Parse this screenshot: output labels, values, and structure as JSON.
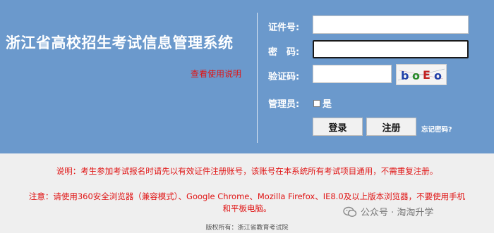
{
  "header": {
    "title": "浙江省高校招生考试信息管理系统",
    "manual_link": "查看使用说明"
  },
  "login_form": {
    "id_label": "证件号:",
    "id_value": "",
    "password_label": "密　码:",
    "password_value": "",
    "captcha_label": "验证码:",
    "captcha_value": "",
    "captcha_image_text": "boEo",
    "admin_label": "管理员:",
    "admin_option": "是",
    "admin_checked": false,
    "login_button": "登录",
    "register_button": "注册",
    "forgot_link": "忘记密码?"
  },
  "notices": {
    "explanation": "说明：考生参加考试报名时请先以有效证件注册账号，该账号在本系统所有考试项目通用，不需重复注册。",
    "attention_line1": "注意：请使用360安全浏览器（兼容模式）、Google Chrome、Mozilla Firefox、IE8.0及以上版本浏览器，不要使用手机",
    "attention_line2": "和平板电脑。"
  },
  "watermark": {
    "text": "公众号 · 淘淘升学",
    "icon": "wechat-icon"
  },
  "footer": {
    "copyright": "版权所有：浙江省教育考试院"
  },
  "colors": {
    "banner": "#6b99cc",
    "notice_red": "#e01414",
    "page_bg": "#efefef"
  }
}
